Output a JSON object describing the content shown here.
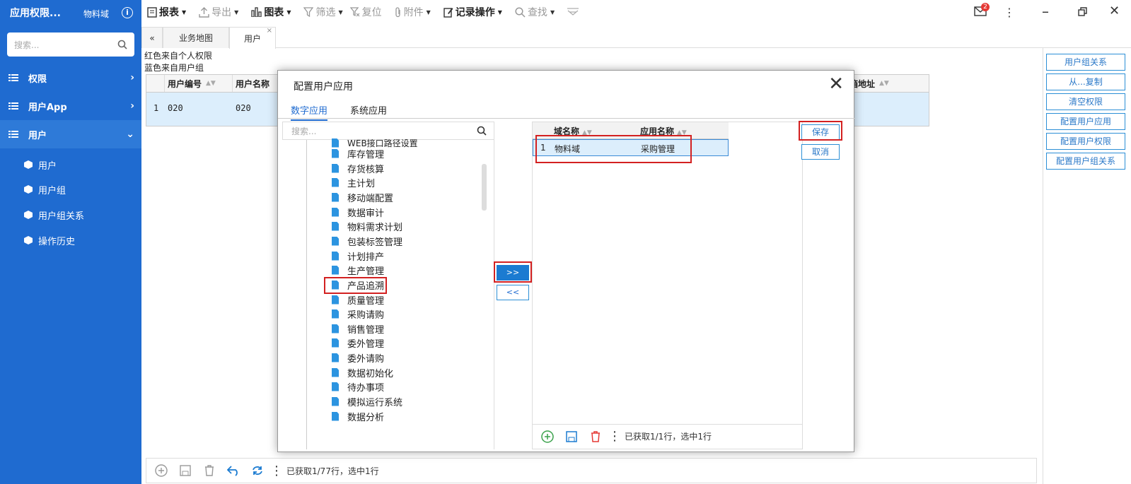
{
  "sidebar": {
    "app_title": "应用权限...",
    "domain": "物料域",
    "search_placeholder": "搜索...",
    "items": [
      {
        "label": "权限"
      },
      {
        "label": "用户App"
      },
      {
        "label": "用户"
      }
    ],
    "subitems": [
      {
        "label": "用户"
      },
      {
        "label": "用户组"
      },
      {
        "label": "用户组关系"
      },
      {
        "label": "操作历史"
      }
    ]
  },
  "toolbar": {
    "report": "报表",
    "export": "导出",
    "chart": "图表",
    "filter": "筛选",
    "reset": "复位",
    "attach": "附件",
    "record_ops": "记录操作",
    "find": "查找",
    "mail_badge": "2"
  },
  "tabs": {
    "collapse": "«",
    "items": [
      {
        "label": "业务地图"
      },
      {
        "label": "用户"
      }
    ],
    "close": "×"
  },
  "legend": {
    "red": "红色来自个人权限",
    "blue": "蓝色来自用户组"
  },
  "grid": {
    "columns": [
      {
        "label": "用户编号"
      },
      {
        "label": "用户名称"
      },
      {
        "label": "箱地址"
      }
    ],
    "rows": [
      {
        "idx": "1",
        "code": "020",
        "name": "020"
      }
    ],
    "footer_status": "已获取1/77行，选中1行"
  },
  "right_buttons": [
    {
      "label": "用户组关系"
    },
    {
      "label": "从...复制"
    },
    {
      "label": "清空权限"
    },
    {
      "label": "配置用户应用"
    },
    {
      "label": "配置用户权限"
    },
    {
      "label": "配置用户组关系"
    }
  ],
  "dialog": {
    "title": "配置用户应用",
    "tabs": [
      {
        "label": "数字应用"
      },
      {
        "label": "系统应用"
      }
    ],
    "search_placeholder": "搜索...",
    "tree": [
      {
        "label": "WEB接口路径设置"
      },
      {
        "label": "库存管理"
      },
      {
        "label": "存货核算"
      },
      {
        "label": "主计划"
      },
      {
        "label": "移动端配置"
      },
      {
        "label": "数据审计"
      },
      {
        "label": "物料需求计划"
      },
      {
        "label": "包装标签管理"
      },
      {
        "label": "计划排产"
      },
      {
        "label": "生产管理"
      },
      {
        "label": "产品追溯"
      },
      {
        "label": "质量管理"
      },
      {
        "label": "采购请购"
      },
      {
        "label": "销售管理"
      },
      {
        "label": "委外管理"
      },
      {
        "label": "委外请购"
      },
      {
        "label": "数据初始化"
      },
      {
        "label": "待办事项"
      },
      {
        "label": "模拟运行系统"
      },
      {
        "label": "数据分析"
      }
    ],
    "move_right": ">>",
    "move_left": "<<",
    "right_grid": {
      "columns": [
        {
          "label": "域名称"
        },
        {
          "label": "应用名称"
        }
      ],
      "rows": [
        {
          "idx": "1",
          "domain": "物料域",
          "app": "采购管理"
        }
      ],
      "footer_status": "已获取1/1行，选中1行"
    },
    "save": "保存",
    "cancel": "取消"
  },
  "colors": {
    "sidebar": "#1f6bd0",
    "accent": "#1b7bd1",
    "highlight": "#d32121",
    "selected_row": "#dceefc"
  }
}
